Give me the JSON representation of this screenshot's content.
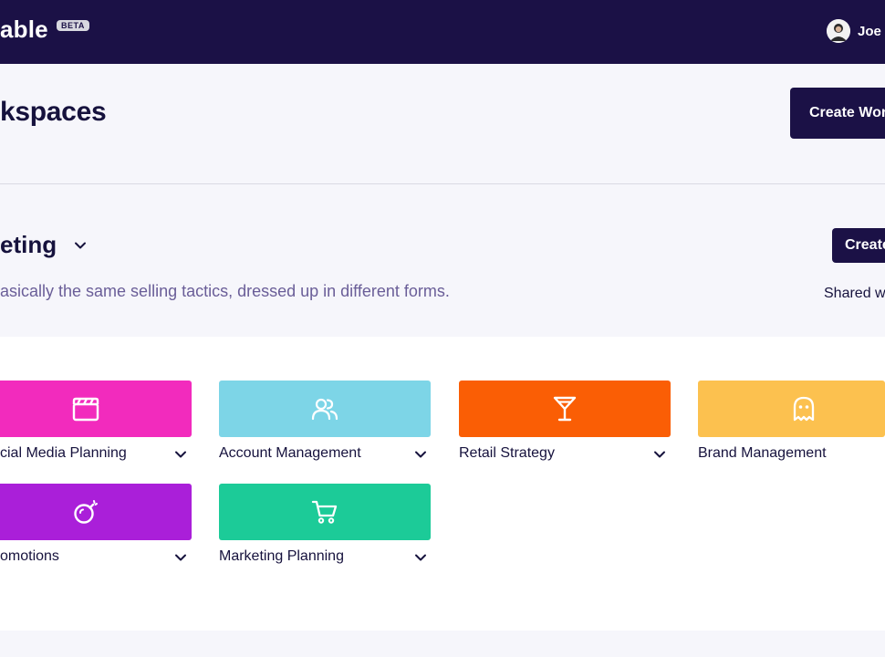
{
  "header": {
    "brand": "able",
    "beta_badge": "BETA",
    "user_name": "Joe"
  },
  "page": {
    "title": "kspaces",
    "create_workspace_label": "Create Wor"
  },
  "workspace": {
    "name": "eting",
    "description": "asically the same selling tactics, dressed up in different forms.",
    "create_board_label": "Create",
    "shared_label": "Shared w"
  },
  "boards": [
    {
      "label": "cial Media Planning",
      "color": "#f22bbd",
      "icon": "clapperboard-icon"
    },
    {
      "label": "Account Management",
      "color": "#7dd5e7",
      "icon": "users-icon"
    },
    {
      "label": "Retail Strategy",
      "color": "#fa5e05",
      "icon": "cocktail-icon"
    },
    {
      "label": "Brand Management",
      "color": "#fcc14f",
      "icon": "ghost-icon"
    },
    {
      "label": "omotions",
      "color": "#aa1fd9",
      "icon": "bomb-icon"
    },
    {
      "label": "Marketing Planning",
      "color": "#1ccb98",
      "icon": "shopping-cart-icon"
    }
  ],
  "colors": {
    "topbar": "#1b1146",
    "primary_button": "#1b1146",
    "description_text": "#6a5e98"
  }
}
